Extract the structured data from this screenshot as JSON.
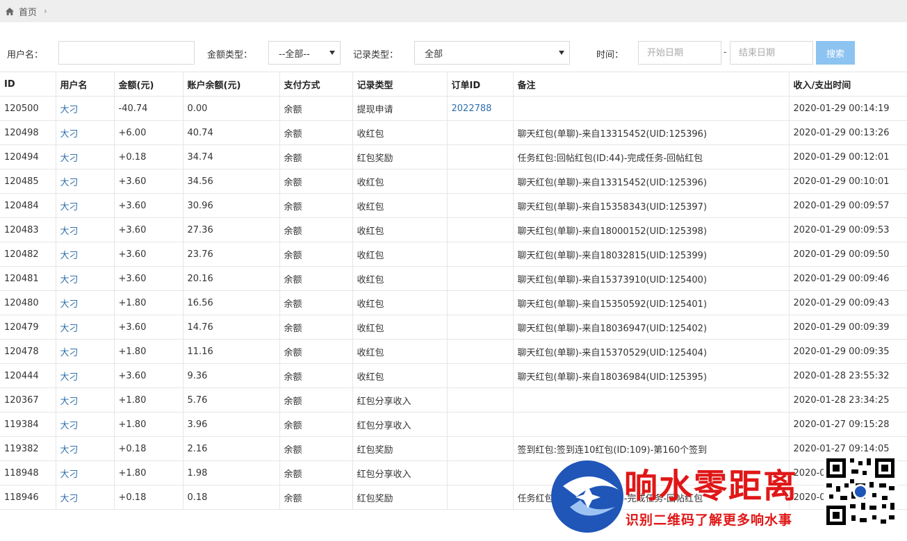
{
  "breadcrumb": {
    "home": "首页"
  },
  "filters": {
    "username_label": "用户名：",
    "username_value": "",
    "amount_type_label": "金额类型：",
    "amount_type_value": "--全部--",
    "record_type_label": "记录类型：",
    "record_type_value": "全部",
    "time_label": "时间：",
    "start_placeholder": "开始日期",
    "dash": "-",
    "end_placeholder": "结束日期",
    "search_label": "搜索"
  },
  "table": {
    "headers": [
      "ID",
      "用户名",
      "金额(元)",
      "账户余额(元)",
      "支付方式",
      "记录类型",
      "订单ID",
      "备注",
      "收入/支出时间"
    ],
    "rows": [
      [
        "120500",
        "大刁",
        "-40.74",
        "0.00",
        "余额",
        "提现申请",
        "2022788",
        "",
        "2020-01-29 00:14:19"
      ],
      [
        "120498",
        "大刁",
        "+6.00",
        "40.74",
        "余额",
        "收红包",
        "",
        "聊天红包(单聊)-来自13315452(UID:125396)",
        "2020-01-29 00:13:26"
      ],
      [
        "120494",
        "大刁",
        "+0.18",
        "34.74",
        "余额",
        "红包奖励",
        "",
        "任务红包:回帖红包(ID:44)-完成任务-回帖红包",
        "2020-01-29 00:12:01"
      ],
      [
        "120485",
        "大刁",
        "+3.60",
        "34.56",
        "余额",
        "收红包",
        "",
        "聊天红包(单聊)-来自13315452(UID:125396)",
        "2020-01-29 00:10:01"
      ],
      [
        "120484",
        "大刁",
        "+3.60",
        "30.96",
        "余额",
        "收红包",
        "",
        "聊天红包(单聊)-来自15358343(UID:125397)",
        "2020-01-29 00:09:57"
      ],
      [
        "120483",
        "大刁",
        "+3.60",
        "27.36",
        "余额",
        "收红包",
        "",
        "聊天红包(单聊)-来自18000152(UID:125398)",
        "2020-01-29 00:09:53"
      ],
      [
        "120482",
        "大刁",
        "+3.60",
        "23.76",
        "余额",
        "收红包",
        "",
        "聊天红包(单聊)-来自18032815(UID:125399)",
        "2020-01-29 00:09:50"
      ],
      [
        "120481",
        "大刁",
        "+3.60",
        "20.16",
        "余额",
        "收红包",
        "",
        "聊天红包(单聊)-来自15373910(UID:125400)",
        "2020-01-29 00:09:46"
      ],
      [
        "120480",
        "大刁",
        "+1.80",
        "16.56",
        "余额",
        "收红包",
        "",
        "聊天红包(单聊)-来自15350592(UID:125401)",
        "2020-01-29 00:09:43"
      ],
      [
        "120479",
        "大刁",
        "+3.60",
        "14.76",
        "余额",
        "收红包",
        "",
        "聊天红包(单聊)-来自18036947(UID:125402)",
        "2020-01-29 00:09:39"
      ],
      [
        "120478",
        "大刁",
        "+1.80",
        "11.16",
        "余额",
        "收红包",
        "",
        "聊天红包(单聊)-来自15370529(UID:125404)",
        "2020-01-29 00:09:35"
      ],
      [
        "120444",
        "大刁",
        "+3.60",
        "9.36",
        "余额",
        "收红包",
        "",
        "聊天红包(单聊)-来自18036984(UID:125395)",
        "2020-01-28 23:55:32"
      ],
      [
        "120367",
        "大刁",
        "+1.80",
        "5.76",
        "余额",
        "红包分享收入",
        "",
        "",
        "2020-01-28 23:34:25"
      ],
      [
        "119384",
        "大刁",
        "+1.80",
        "3.96",
        "余额",
        "红包分享收入",
        "",
        "",
        "2020-01-27 09:15:28"
      ],
      [
        "119382",
        "大刁",
        "+0.18",
        "2.16",
        "余额",
        "红包奖励",
        "",
        "签到红包:签到连10红包(ID:109)-第160个签到",
        "2020-01-27 09:14:05"
      ],
      [
        "118948",
        "大刁",
        "+1.80",
        "1.98",
        "余额",
        "红包分享收入",
        "",
        "",
        "2020-0"
      ],
      [
        "118946",
        "大刁",
        "+0.18",
        "0.18",
        "余额",
        "红包奖励",
        "",
        "任务红包:回帖红包(ID:44)-完成任务-回帖红包",
        "2020-0"
      ]
    ]
  },
  "watermark": {
    "title": "响水零距离",
    "subtitle": "识别二维码了解更多响水事"
  },
  "colors": {
    "link": "#2f6fab",
    "search_button": "#8cc3f0",
    "watermark_red": "#e01717",
    "logo_blue": "#1f56b8"
  }
}
